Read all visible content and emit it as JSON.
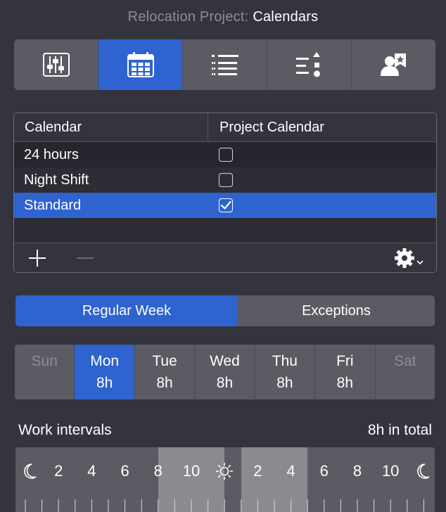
{
  "header": {
    "label": "Relocation Project:",
    "value": "Calendars"
  },
  "toolbar": {
    "tabs": [
      {
        "icon": "sliders-icon",
        "active": false
      },
      {
        "icon": "calendar-icon",
        "active": true
      },
      {
        "icon": "list-icon",
        "active": false
      },
      {
        "icon": "sorted-list-icon",
        "active": false
      },
      {
        "icon": "person-star-icon",
        "active": false
      }
    ]
  },
  "calendars": {
    "columns": [
      "Calendar",
      "Project Calendar"
    ],
    "rows": [
      {
        "name": "24 hours",
        "project_calendar": false,
        "selected": false
      },
      {
        "name": "Night Shift",
        "project_calendar": false,
        "selected": false
      },
      {
        "name": "Standard",
        "project_calendar": true,
        "selected": true
      }
    ]
  },
  "week_toggle": {
    "options": [
      "Regular Week",
      "Exceptions"
    ],
    "selected": "Regular Week"
  },
  "days": [
    {
      "name": "Sun",
      "hours": "",
      "working": false,
      "selected": false
    },
    {
      "name": "Mon",
      "hours": "8h",
      "working": true,
      "selected": true
    },
    {
      "name": "Tue",
      "hours": "8h",
      "working": true,
      "selected": false
    },
    {
      "name": "Wed",
      "hours": "8h",
      "working": true,
      "selected": false
    },
    {
      "name": "Thu",
      "hours": "8h",
      "working": true,
      "selected": false
    },
    {
      "name": "Fri",
      "hours": "8h",
      "working": true,
      "selected": false
    },
    {
      "name": "Sat",
      "hours": "",
      "working": false,
      "selected": false
    }
  ],
  "work_intervals": {
    "label": "Work intervals",
    "total": "8h in total",
    "hour_labels": [
      "2",
      "4",
      "6",
      "8",
      "10",
      "2",
      "4",
      "6",
      "8",
      "10"
    ],
    "intervals": [
      {
        "start": 8,
        "end": 12
      },
      {
        "start": 13,
        "end": 17
      }
    ]
  },
  "colors": {
    "accent": "#2e63d0",
    "background": "#33343d",
    "segment": "#5b5c63",
    "interval_fill": "#8a8b90",
    "muted_text": "#8d8e95"
  }
}
